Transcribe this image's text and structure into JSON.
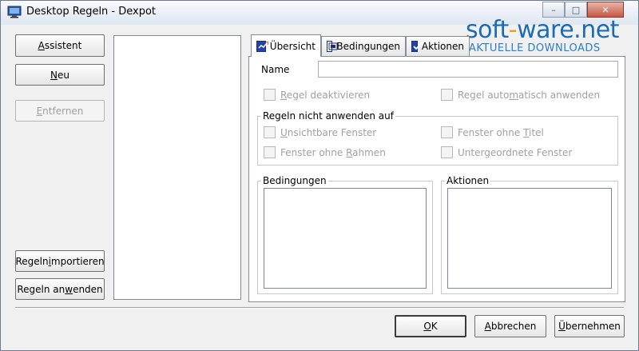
{
  "window": {
    "title": "Desktop Regeln - Dexpot"
  },
  "titlebar_buttons": {
    "minimize": "–",
    "maximize": "□",
    "close": "✕"
  },
  "left_buttons": {
    "assistant": {
      "pre": "",
      "key": "A",
      "post": "ssistent"
    },
    "new": {
      "pre": "",
      "key": "N",
      "post": "eu"
    },
    "remove": {
      "pre": "",
      "key": "E",
      "post": "ntfernen"
    },
    "import": {
      "pre": "Regeln ",
      "key": "i",
      "post": "mportieren"
    },
    "apply": {
      "pre": "Regeln an",
      "key": "w",
      "post": "enden"
    }
  },
  "tabs": [
    {
      "label": "Übersicht",
      "icon": "overview-icon"
    },
    {
      "label": "Bedingungen",
      "icon": "window-icon"
    },
    {
      "label": "Aktionen",
      "icon": "check-icon"
    }
  ],
  "overview": {
    "name_label": "Name",
    "name_value": "",
    "disable_rule": {
      "pre": "",
      "key": "R",
      "post": "egel deaktivieren"
    },
    "auto_apply": {
      "pre": "Regel auto",
      "key": "m",
      "post": "atisch anwenden"
    },
    "exclusions_title": "Regeln nicht anwenden auf",
    "invisible_windows": {
      "pre": "",
      "key": "U",
      "post": "nsichtbare Fenster"
    },
    "windows_no_title": {
      "pre": "Fenster ohne ",
      "key": "T",
      "post": "itel"
    },
    "windows_no_frame": {
      "pre": "Fenster ohne ",
      "key": "R",
      "post": "ahmen"
    },
    "child_windows": {
      "pre": "Unter",
      "key": "g",
      "post": "eordnete Fenster"
    },
    "conditions_title": "Bedingungen",
    "actions_title": "Aktionen"
  },
  "bottom_buttons": {
    "ok": {
      "pre": "",
      "key": "O",
      "post": "K"
    },
    "cancel": {
      "pre": "",
      "key": "A",
      "post": "bbrechen"
    },
    "apply": {
      "pre": "",
      "key": "Ü",
      "post": "bernehmen"
    }
  },
  "watermark": {
    "brand_a": "soft",
    "dash": "-",
    "brand_b": "ware",
    "tld": ".net",
    "tagline": "AKTUELLE DOWNLOADS"
  },
  "colors": {
    "accent": "#1a4fa0",
    "watermark": "#1b6bb5",
    "disabled_text": "#a0a0a0"
  }
}
